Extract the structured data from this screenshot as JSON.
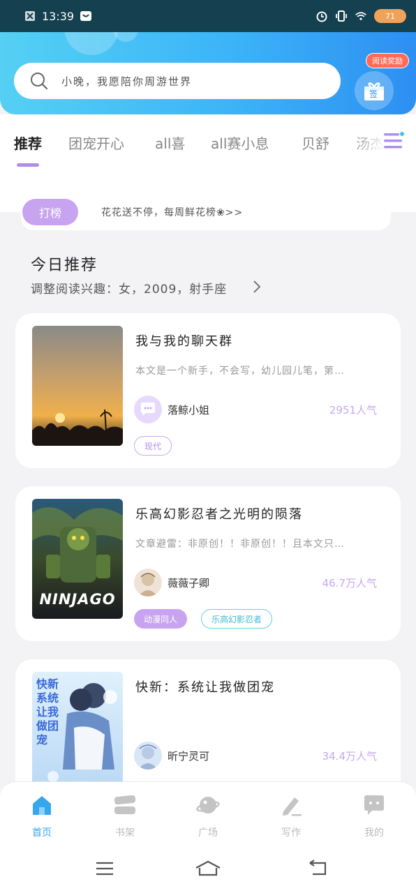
{
  "status_bar": {
    "time": "13:39",
    "battery": "71"
  },
  "search": {
    "placeholder": "小晚，我愿陪你周游世界"
  },
  "reward": {
    "badge": "阅读奖励",
    "gift_label": "签"
  },
  "tabs": [
    {
      "label": "推荐",
      "active": true
    },
    {
      "label": "团宠开心",
      "active": false
    },
    {
      "label": "all喜",
      "active": false
    },
    {
      "label": "all赛小息",
      "active": false
    },
    {
      "label": "贝舒",
      "active": false
    },
    {
      "label": "汤杰",
      "active": false
    }
  ],
  "notice": {
    "button": "打榜",
    "text": "花花送不停，每周鲜花榜❀>>"
  },
  "section": {
    "title": "今日推荐",
    "subtitle": "调整阅读兴趣：女，2009，射手座"
  },
  "books": [
    {
      "title": "我与我的聊天群",
      "desc": "本文是一个新手，不会写，幼儿园儿笔，第…",
      "author": "落鲸小姐",
      "popularity": "2951人气",
      "tags": [
        "现代"
      ]
    },
    {
      "title": "乐高幻影忍者之光明的陨落",
      "desc": "文章避雷：非原创！！非原创！！且本文只…",
      "author": "薇薇子卿",
      "popularity": "46.7万人气",
      "tags": [
        "动漫同人",
        "乐高幻影忍者"
      ],
      "cover_text": "NINJAGO"
    },
    {
      "title": "快新：系统让我做团宠",
      "desc": "",
      "author": "昕宁灵可",
      "popularity": "34.4万人气",
      "tags": [],
      "cover_text": "快新系统让我做团宠"
    }
  ],
  "bottom_nav": [
    {
      "label": "首页",
      "active": true
    },
    {
      "label": "书架",
      "active": false
    },
    {
      "label": "广场",
      "active": false
    },
    {
      "label": "写作",
      "active": false
    },
    {
      "label": "我的",
      "active": false
    }
  ],
  "colors": {
    "accent_purple": "#c8a4f0",
    "accent_blue": "#36a6ee",
    "header_gradient_start": "#55d0f3",
    "header_gradient_end": "#2d8ff2"
  }
}
